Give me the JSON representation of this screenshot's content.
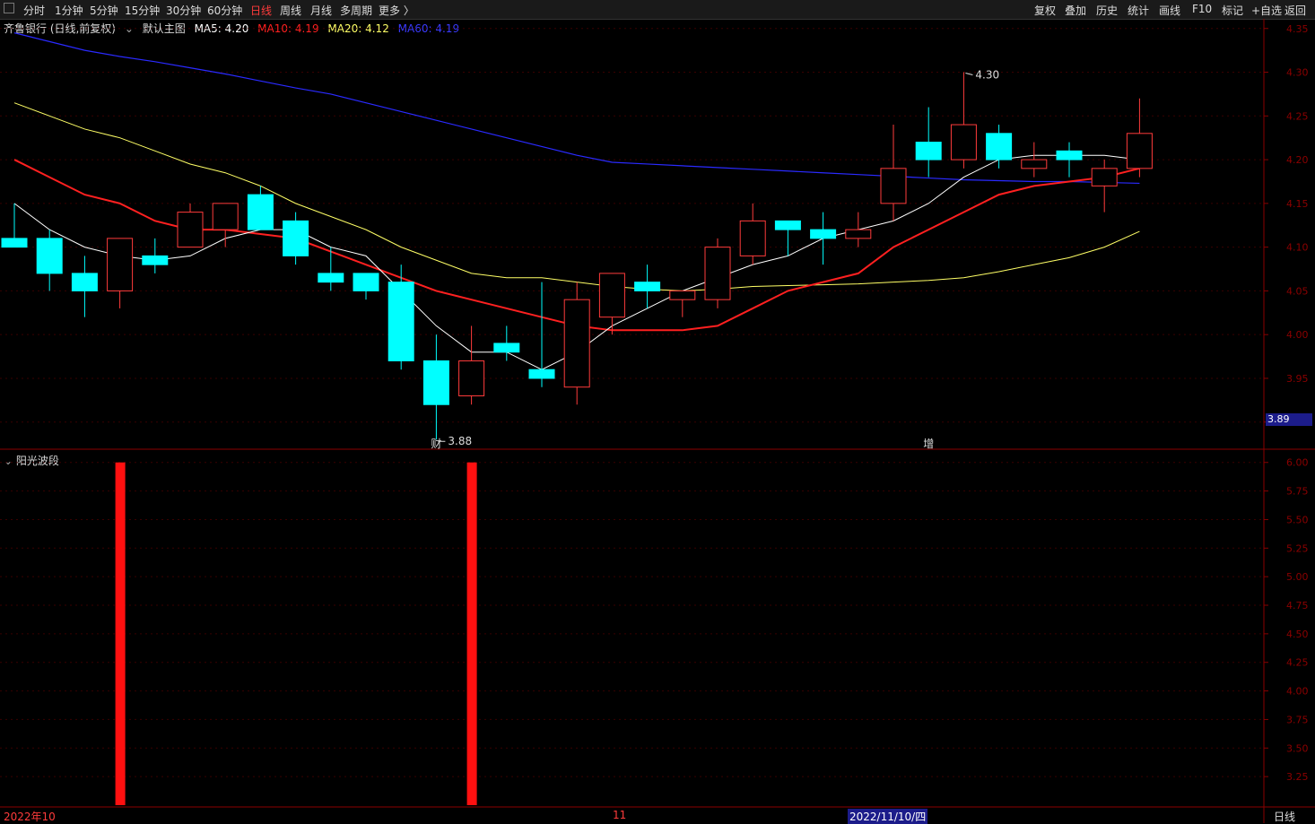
{
  "toolbar": {
    "left": [
      "分时",
      "1分钟",
      "5分钟",
      "15分钟",
      "30分钟",
      "60分钟",
      "日线",
      "周线",
      "月线",
      "多周期",
      "更多 〉"
    ],
    "active_index": 6,
    "right": [
      "复权",
      "叠加",
      "历史",
      "统计",
      "画线",
      "F10",
      "标记",
      "+自选",
      "返回"
    ]
  },
  "legend": {
    "stock": "齐鲁银行 (日线,前复权)",
    "main_chart": "默认主图",
    "ma5": "MA5: 4.20",
    "ma10": "MA10: 4.19",
    "ma20": "MA20: 4.12",
    "ma60": "MA60: 4.19"
  },
  "colors": {
    "up": "#ff3b3b",
    "down": "#00ffff",
    "ma5": "#ffffff",
    "ma10": "#ff2020",
    "ma20": "#ffff66",
    "ma60": "#2a2aff",
    "axis": "#8b0000",
    "grid": "#3a0000"
  },
  "sub_indicator": "阳光波段",
  "current_price_label": "3.89",
  "annotations": {
    "low": "3.88",
    "high": "4.30",
    "event_a": "财",
    "event_b": "增"
  },
  "bottom": {
    "date_left": "2022年10",
    "date_mid": "11",
    "date_cursor": "2022/11/10/四",
    "period": "日线"
  },
  "chart_data": {
    "type": "candlestick",
    "main": {
      "ylim": [
        3.87,
        4.36
      ],
      "y_ticks": [
        "4.35",
        "4.30",
        "4.25",
        "4.20",
        "4.15",
        "4.10",
        "4.05",
        "4.00",
        "3.95",
        "3.90"
      ],
      "candles": [
        {
          "o": 4.11,
          "h": 4.15,
          "l": 4.1,
          "c": 4.1
        },
        {
          "o": 4.11,
          "h": 4.12,
          "l": 4.05,
          "c": 4.07
        },
        {
          "o": 4.07,
          "h": 4.09,
          "l": 4.02,
          "c": 4.05
        },
        {
          "o": 4.05,
          "h": 4.11,
          "l": 4.03,
          "c": 4.11
        },
        {
          "o": 4.09,
          "h": 4.11,
          "l": 4.07,
          "c": 4.08
        },
        {
          "o": 4.1,
          "h": 4.15,
          "l": 4.1,
          "c": 4.14
        },
        {
          "o": 4.12,
          "h": 4.15,
          "l": 4.1,
          "c": 4.15
        },
        {
          "o": 4.16,
          "h": 4.17,
          "l": 4.12,
          "c": 4.12
        },
        {
          "o": 4.13,
          "h": 4.14,
          "l": 4.08,
          "c": 4.09
        },
        {
          "o": 4.07,
          "h": 4.1,
          "l": 4.05,
          "c": 4.06
        },
        {
          "o": 4.07,
          "h": 4.07,
          "l": 4.04,
          "c": 4.05
        },
        {
          "o": 4.06,
          "h": 4.08,
          "l": 3.96,
          "c": 3.97
        },
        {
          "o": 3.97,
          "h": 4.0,
          "l": 3.88,
          "c": 3.92
        },
        {
          "o": 3.93,
          "h": 4.01,
          "l": 3.92,
          "c": 3.97
        },
        {
          "o": 3.99,
          "h": 4.01,
          "l": 3.97,
          "c": 3.98
        },
        {
          "o": 3.96,
          "h": 4.06,
          "l": 3.94,
          "c": 3.95
        },
        {
          "o": 3.94,
          "h": 4.06,
          "l": 3.92,
          "c": 4.04
        },
        {
          "o": 4.02,
          "h": 4.07,
          "l": 4.0,
          "c": 4.07
        },
        {
          "o": 4.06,
          "h": 4.08,
          "l": 4.03,
          "c": 4.05
        },
        {
          "o": 4.04,
          "h": 4.05,
          "l": 4.02,
          "c": 4.05
        },
        {
          "o": 4.04,
          "h": 4.11,
          "l": 4.03,
          "c": 4.1
        },
        {
          "o": 4.09,
          "h": 4.15,
          "l": 4.08,
          "c": 4.13
        },
        {
          "o": 4.13,
          "h": 4.13,
          "l": 4.09,
          "c": 4.12
        },
        {
          "o": 4.12,
          "h": 4.14,
          "l": 4.08,
          "c": 4.11
        },
        {
          "o": 4.11,
          "h": 4.14,
          "l": 4.1,
          "c": 4.12
        },
        {
          "o": 4.15,
          "h": 4.24,
          "l": 4.13,
          "c": 4.19
        },
        {
          "o": 4.22,
          "h": 4.26,
          "l": 4.18,
          "c": 4.2
        },
        {
          "o": 4.2,
          "h": 4.3,
          "l": 4.19,
          "c": 4.24
        },
        {
          "o": 4.23,
          "h": 4.24,
          "l": 4.19,
          "c": 4.2
        },
        {
          "o": 4.19,
          "h": 4.22,
          "l": 4.18,
          "c": 4.2
        },
        {
          "o": 4.21,
          "h": 4.22,
          "l": 4.18,
          "c": 4.2
        },
        {
          "o": 4.17,
          "h": 4.2,
          "l": 4.14,
          "c": 4.19
        },
        {
          "o": 4.19,
          "h": 4.27,
          "l": 4.18,
          "c": 4.23
        }
      ],
      "ma5": [
        4.15,
        4.12,
        4.1,
        4.09,
        4.085,
        4.09,
        4.11,
        4.12,
        4.12,
        4.1,
        4.09,
        4.05,
        4.01,
        3.98,
        3.98,
        3.96,
        3.98,
        4.01,
        4.03,
        4.05,
        4.065,
        4.08,
        4.09,
        4.11,
        4.12,
        4.13,
        4.15,
        4.18,
        4.2,
        4.205,
        4.205,
        4.205,
        4.2
      ],
      "ma10": [
        4.2,
        4.18,
        4.16,
        4.15,
        4.13,
        4.12,
        4.12,
        4.115,
        4.11,
        4.095,
        4.08,
        4.065,
        4.05,
        4.04,
        4.03,
        4.02,
        4.01,
        4.005,
        4.005,
        4.005,
        4.01,
        4.03,
        4.05,
        4.06,
        4.07,
        4.1,
        4.12,
        4.14,
        4.16,
        4.17,
        4.175,
        4.18,
        4.19
      ],
      "ma20": [
        4.265,
        4.25,
        4.235,
        4.225,
        4.21,
        4.195,
        4.185,
        4.17,
        4.15,
        4.135,
        4.12,
        4.1,
        4.085,
        4.07,
        4.065,
        4.065,
        4.06,
        4.055,
        4.052,
        4.05,
        4.052,
        4.055,
        4.056,
        4.057,
        4.058,
        4.06,
        4.062,
        4.065,
        4.072,
        4.08,
        4.088,
        4.1,
        4.118
      ],
      "ma60": [
        4.345,
        4.335,
        4.325,
        4.318,
        4.312,
        4.305,
        4.298,
        4.29,
        4.282,
        4.275,
        4.265,
        4.255,
        4.245,
        4.235,
        4.225,
        4.215,
        4.205,
        4.197,
        4.195,
        4.193,
        4.191,
        4.189,
        4.187,
        4.185,
        4.183,
        4.181,
        4.179,
        4.177,
        4.176,
        4.175,
        4.175,
        4.174,
        4.173
      ]
    },
    "sub": {
      "ylim": [
        3.0,
        6.1
      ],
      "y_ticks": [
        "6.00",
        "5.75",
        "5.50",
        "5.25",
        "5.00",
        "4.75",
        "4.50",
        "4.25",
        "4.00",
        "3.75",
        "3.50",
        "3.25"
      ],
      "signal_bars_at_candle": [
        3,
        13
      ]
    }
  }
}
